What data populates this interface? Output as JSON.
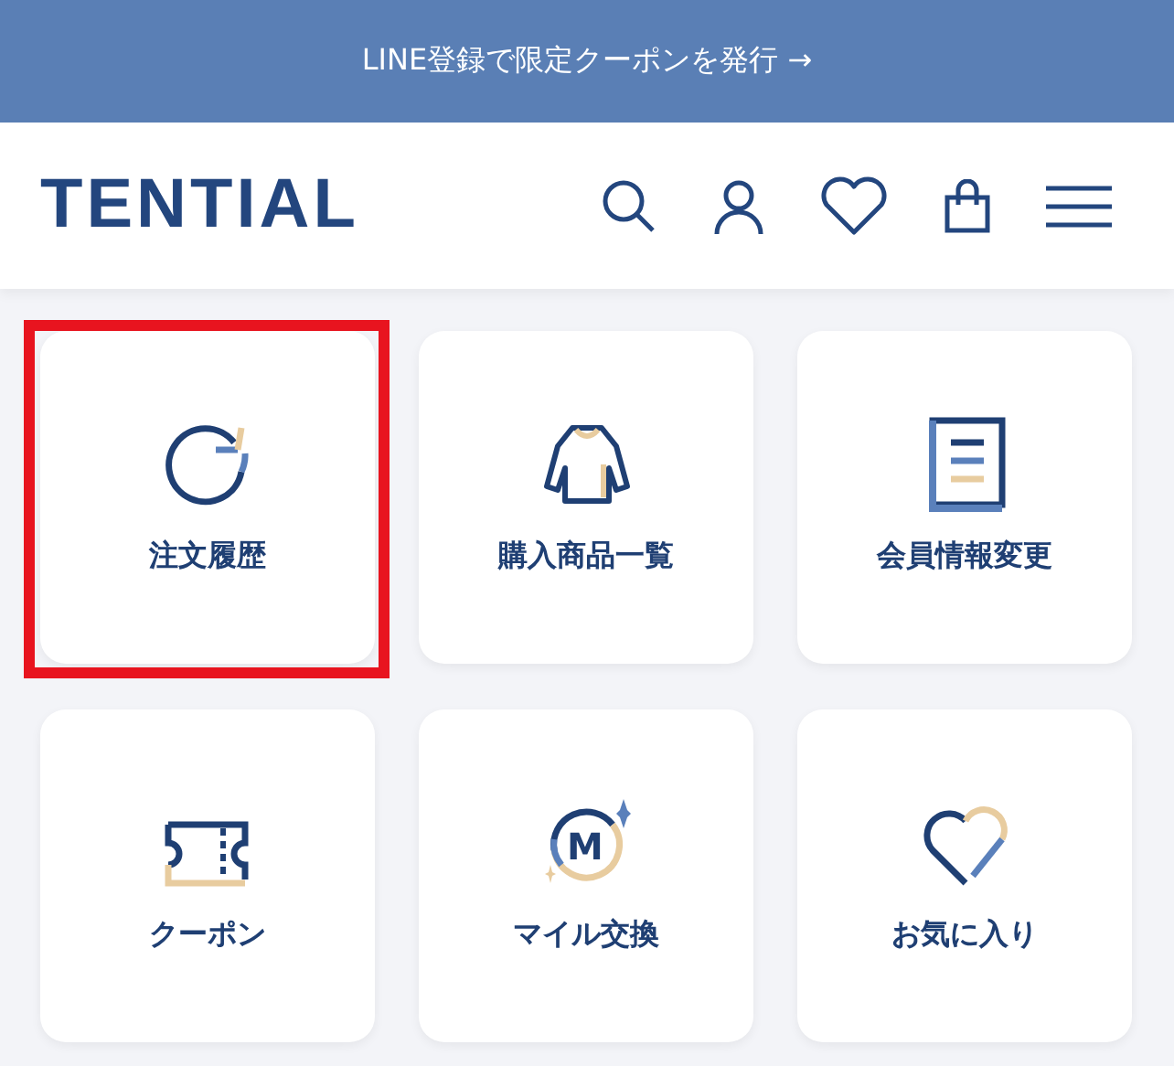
{
  "banner": {
    "text": "LINE登録で限定クーポンを発行 →"
  },
  "header": {
    "logo": "TENTIAL"
  },
  "menu": [
    {
      "label": "注文履歴",
      "kind": "history",
      "selected": true
    },
    {
      "label": "購入商品一覧",
      "kind": "purchases",
      "selected": false
    },
    {
      "label": "会員情報変更",
      "kind": "profile",
      "selected": false
    },
    {
      "label": "クーポン",
      "kind": "coupon",
      "selected": false
    },
    {
      "label": "マイル交換",
      "kind": "mile",
      "icon_letter": "M",
      "selected": false
    },
    {
      "label": "お気に入り",
      "kind": "favorite",
      "selected": false
    }
  ]
}
